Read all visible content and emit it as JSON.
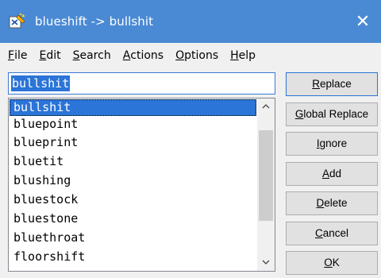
{
  "window": {
    "title": "blueshift -> bullshit",
    "close_glyph": "✕",
    "app_icon": "replace-app-icon"
  },
  "menu": [
    {
      "mnemonic": "F",
      "rest": "ile"
    },
    {
      "mnemonic": "E",
      "rest": "dit"
    },
    {
      "mnemonic": "S",
      "rest": "earch"
    },
    {
      "mnemonic": "A",
      "rest": "ctions"
    },
    {
      "mnemonic": "O",
      "rest": "ptions"
    },
    {
      "mnemonic": "H",
      "rest": "elp"
    }
  ],
  "search": {
    "value": "bullshit"
  },
  "list": {
    "items": [
      "bullshit",
      "bluepoint",
      "blueprint",
      "bluetit",
      "blushing",
      "bluestock",
      "bluestone",
      "bluethroat",
      "floorshift"
    ],
    "selected_index": 0
  },
  "buttons": [
    {
      "pre": "",
      "mnemonic": "R",
      "post": "eplace"
    },
    {
      "pre": "",
      "mnemonic": "G",
      "post": "lobal Replace"
    },
    {
      "pre": "",
      "mnemonic": "I",
      "post": "gnore"
    },
    {
      "pre": "",
      "mnemonic": "A",
      "post": "dd"
    },
    {
      "pre": "",
      "mnemonic": "D",
      "post": "elete"
    },
    {
      "pre": "",
      "mnemonic": "C",
      "post": "ancel"
    },
    {
      "pre": "",
      "mnemonic": "O",
      "post": "K"
    }
  ],
  "colors": {
    "titlebar": "#4a8ad4",
    "selection": "#2b74d8",
    "face": "#f0f0f0"
  }
}
